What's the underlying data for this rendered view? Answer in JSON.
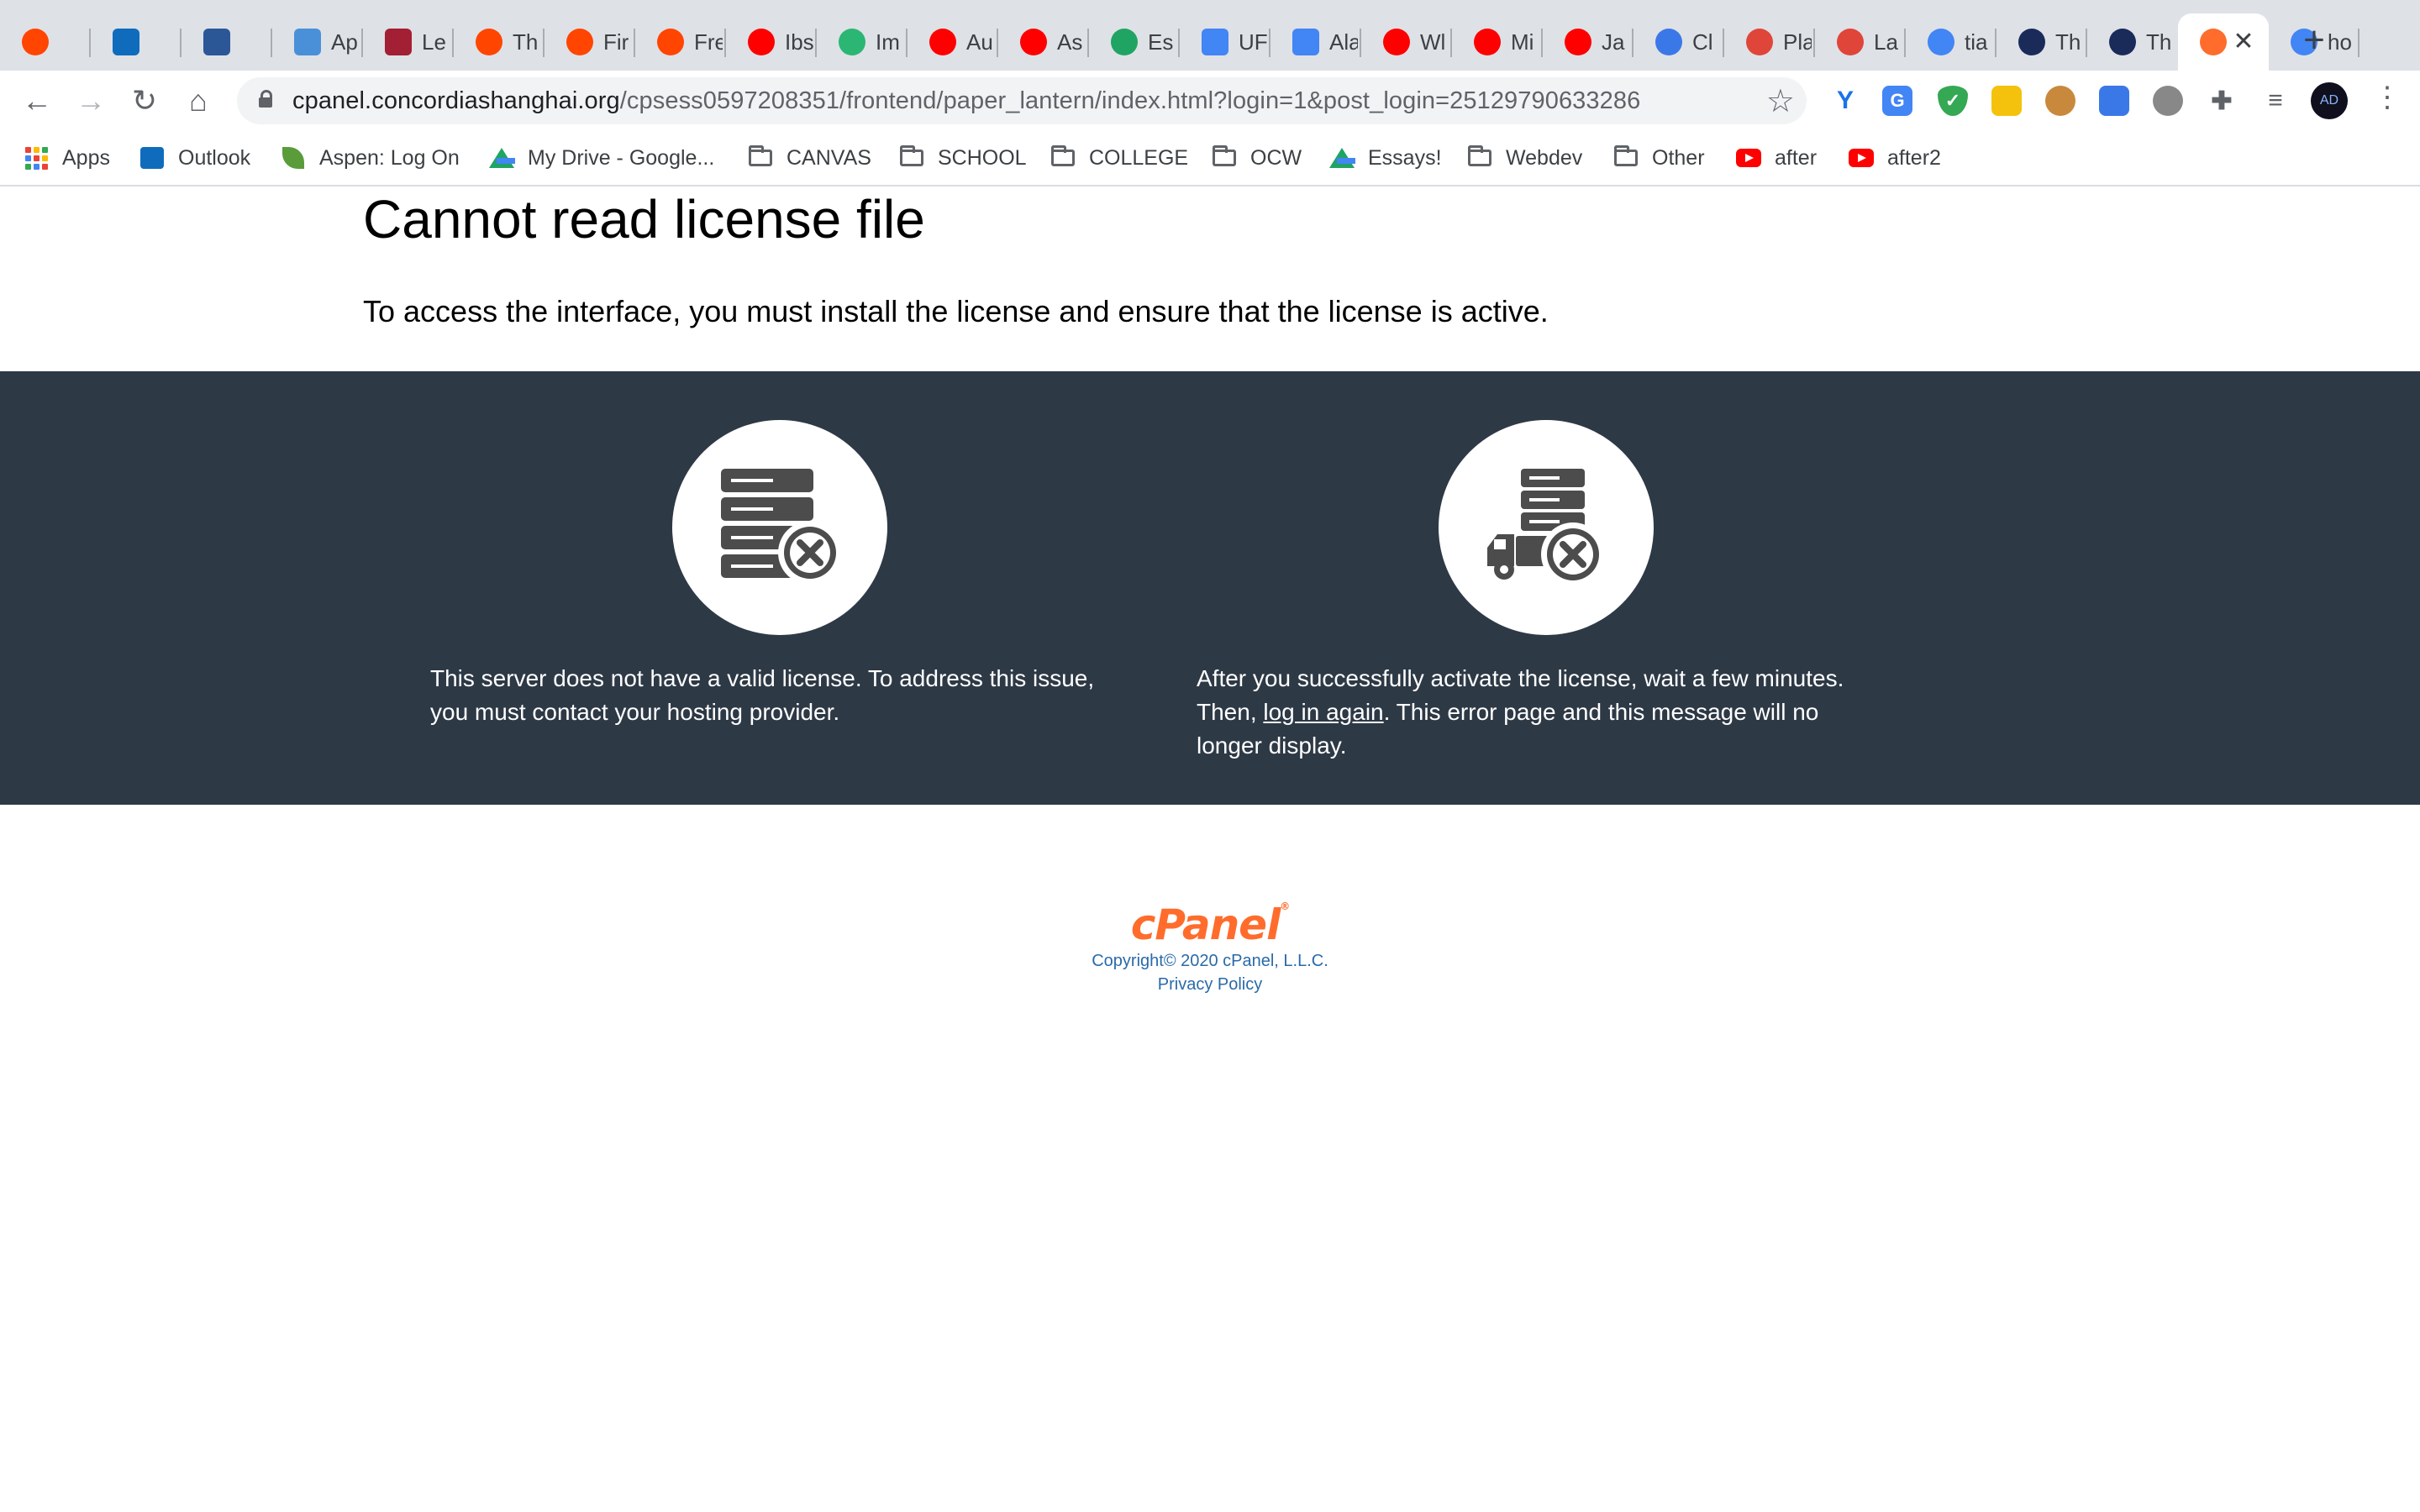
{
  "browser": {
    "tabs": [
      {
        "title": "",
        "icon": "reddit-icon",
        "color": "#ff4500"
      },
      {
        "title": "",
        "icon": "outlook-icon",
        "color": "#0f6cbd"
      },
      {
        "title": "",
        "icon": "calendar-app-icon",
        "color": "#2b5797"
      },
      {
        "title": "Ap",
        "icon": "typing-app-icon",
        "color": "#4a90d9"
      },
      {
        "title": "Le",
        "icon": "mit-ocw-icon",
        "color": "#a31f34"
      },
      {
        "title": "Th",
        "icon": "reddit-icon",
        "color": "#ff4500"
      },
      {
        "title": "Fir",
        "icon": "reddit-icon",
        "color": "#ff4500"
      },
      {
        "title": "Fre",
        "icon": "reddit-icon",
        "color": "#ff4500"
      },
      {
        "title": "Ibs",
        "icon": "youtube-icon",
        "color": "#ff0000"
      },
      {
        "title": "Im",
        "icon": "vue-shield-icon",
        "color": "#2bb673"
      },
      {
        "title": "Au",
        "icon": "youtube-icon",
        "color": "#ff0000"
      },
      {
        "title": "As",
        "icon": "youtube-icon",
        "color": "#ff0000"
      },
      {
        "title": "Es",
        "icon": "google-drive-icon",
        "color": "#1fa463"
      },
      {
        "title": "UF",
        "icon": "google-docs-icon",
        "color": "#4285f4"
      },
      {
        "title": "Ala",
        "icon": "google-docs-icon",
        "color": "#4285f4"
      },
      {
        "title": "Wl",
        "icon": "youtube-icon",
        "color": "#ff0000"
      },
      {
        "title": "Mi",
        "icon": "youtube-icon",
        "color": "#ff0000"
      },
      {
        "title": "Ja",
        "icon": "youtube-icon",
        "color": "#ff0000"
      },
      {
        "title": "Cl",
        "icon": "shield-icon",
        "color": "#3b78e7"
      },
      {
        "title": "Pla",
        "icon": "wheel-icon",
        "color": "#e0453a"
      },
      {
        "title": "La",
        "icon": "wheel-icon",
        "color": "#e0453a"
      },
      {
        "title": "tia",
        "icon": "google-icon",
        "color": "#4285f4"
      },
      {
        "title": "Th",
        "icon": "compass-icon",
        "color": "#1a2b5a"
      },
      {
        "title": "Th",
        "icon": "compass-icon",
        "color": "#1a2b5a"
      },
      {
        "title": "",
        "icon": "cpanel-icon",
        "color": "#ff6c2c",
        "active": true
      },
      {
        "title": "ho",
        "icon": "google-icon",
        "color": "#4285f4"
      }
    ],
    "new_tab_label": "+",
    "close_label": "✕",
    "url_host": "cpanel.concordiashanghai.org",
    "url_path": "/cpsess0597208351/frontend/paper_lantern/index.html?login=1&post_login=25129790633286",
    "nav": {
      "back": "←",
      "forward": "→",
      "reload": "↻",
      "home": "⌂",
      "star": "☆",
      "menu": "⋮"
    },
    "profile_initials": "AD",
    "bookmarks": [
      {
        "label": "Apps",
        "icon": "apps-grid-icon"
      },
      {
        "label": "Outlook",
        "icon": "outlook-icon"
      },
      {
        "label": "Aspen: Log On",
        "icon": "aspen-leaf-icon"
      },
      {
        "label": "My Drive - Google...",
        "icon": "google-drive-icon"
      },
      {
        "label": "CANVAS",
        "icon": "folder-icon"
      },
      {
        "label": "SCHOOL",
        "icon": "folder-icon"
      },
      {
        "label": "COLLEGE",
        "icon": "folder-icon"
      },
      {
        "label": "OCW",
        "icon": "folder-icon"
      },
      {
        "label": "Essays!",
        "icon": "google-drive-icon"
      },
      {
        "label": "Webdev",
        "icon": "folder-icon"
      },
      {
        "label": "Other",
        "icon": "folder-icon"
      },
      {
        "label": "after",
        "icon": "youtube-icon"
      },
      {
        "label": "after2",
        "icon": "youtube-icon"
      }
    ]
  },
  "page": {
    "title": "Cannot read license file",
    "subtitle": "To access the interface, you must install the license and ensure that the license is active.",
    "left_card": {
      "icon": "server-error-icon",
      "text": "This server does not have a valid license. To address this issue, you must contact your hosting provider."
    },
    "right_card": {
      "icon": "server-truck-error-icon",
      "text_before": "After you successfully activate the license, wait a few minutes. Then, ",
      "link": "log in again",
      "text_after": ". This error page and this message will no longer display."
    },
    "footer": {
      "logo": "cPanel",
      "logo_mark": "®",
      "copyright": "Copyright© 2020 cPanel, L.L.C.",
      "privacy": "Privacy Policy"
    },
    "colors": {
      "band": "#2e3946",
      "icon": "#4c4c4c",
      "brand": "#ff6c2c",
      "link": "#2a6aa8"
    }
  }
}
